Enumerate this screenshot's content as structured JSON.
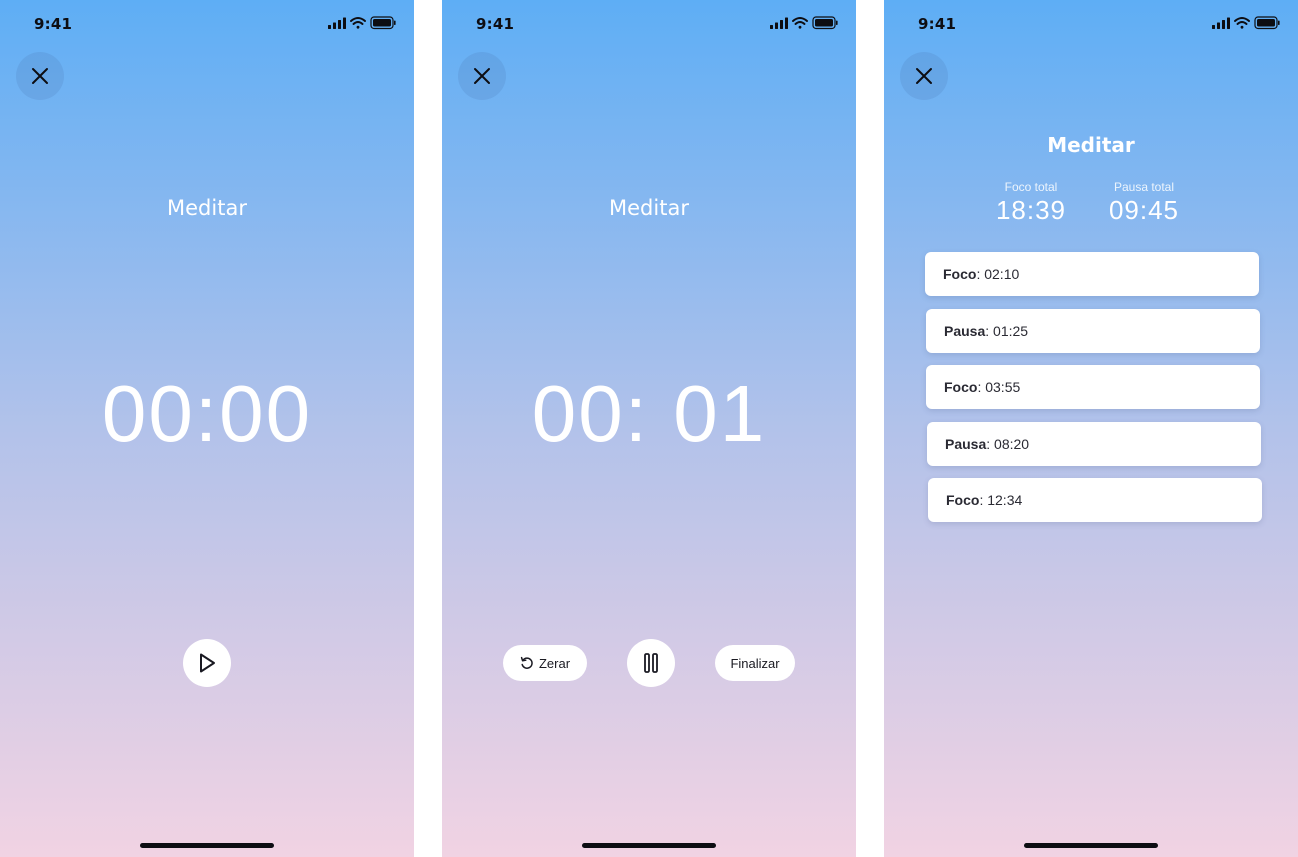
{
  "status_bar": {
    "time": "9:41"
  },
  "screens": [
    {
      "title": "Meditar",
      "timer": "00:00"
    },
    {
      "title": "Meditar",
      "timer": "00: 01",
      "buttons": {
        "reset_label": "Zerar",
        "finish_label": "Finalizar"
      }
    },
    {
      "title": "Meditar",
      "stats": [
        {
          "label": "Foco total",
          "value": "18:39"
        },
        {
          "label": "Pausa total",
          "value": "09:45"
        }
      ],
      "log": [
        {
          "type": "Foco",
          "sep": ": ",
          "time": "02:10"
        },
        {
          "type": "Pausa",
          "sep": ": ",
          "time": "01:25"
        },
        {
          "type": "Foco",
          "sep": ": ",
          "time": "03:55"
        },
        {
          "type": "Pausa",
          "sep": ": ",
          "time": "08:20"
        },
        {
          "type": "Foco",
          "sep": ": ",
          "time": "12:34"
        }
      ]
    }
  ],
  "icons": {
    "close": "close-icon",
    "play": "play-icon",
    "pause": "pause-icon",
    "reset": "reset-icon",
    "signal": "signal-icon",
    "wifi": "wifi-icon",
    "battery": "battery-icon"
  },
  "colors": {
    "gradient_top": "#5eaef5",
    "gradient_bottom": "#f1d3e3",
    "text_dark": "#0d0d12",
    "white": "#ffffff"
  }
}
